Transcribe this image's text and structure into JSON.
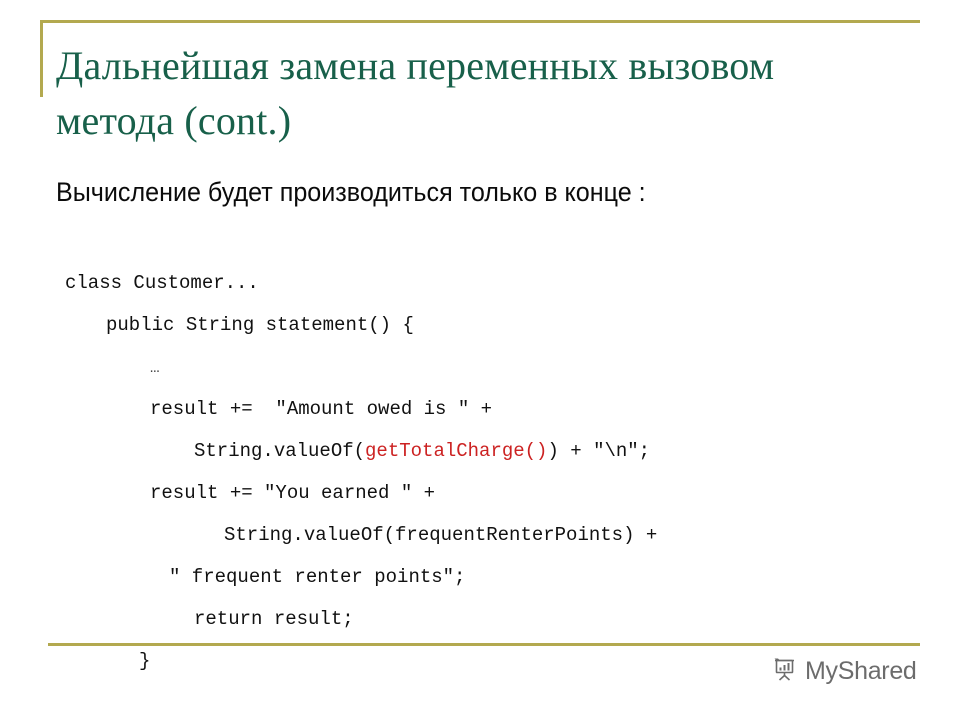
{
  "slide": {
    "title": "Дальнейшая замена переменных вызовом метода (cont.)",
    "subtitle": "Вычисление будет производиться только в конце :",
    "accent_gold": "#b3a94f",
    "title_green": "#18604a",
    "code_red": "#cc2222",
    "code_black": "#111111",
    "background": "#ffffff"
  },
  "code": {
    "lines": [
      {
        "indent": "i0",
        "segments": [
          {
            "text": "class Customer...",
            "style": "plain"
          }
        ]
      },
      {
        "indent": "i1",
        "segments": [
          {
            "text": "public String statement() {",
            "style": "plain"
          }
        ]
      },
      {
        "indent": "i2",
        "segments": [
          {
            "text": "…",
            "style": "plain"
          }
        ]
      },
      {
        "indent": "i2",
        "segments": [
          {
            "text": "result +=  \"Amount owed is \" +",
            "style": "plain"
          }
        ]
      },
      {
        "indent": "i3",
        "segments": [
          {
            "text": "String.valueOf(",
            "style": "plain"
          },
          {
            "text": "getTotalCharge()",
            "style": "red"
          },
          {
            "text": ") + \"\\n\";",
            "style": "plain"
          }
        ]
      },
      {
        "indent": "i2",
        "segments": [
          {
            "text": "result += \"You earned \" +",
            "style": "plain"
          }
        ]
      },
      {
        "indent": "i4",
        "segments": [
          {
            "text": "String.valueOf(frequentRenterPoints) +",
            "style": "plain"
          }
        ]
      },
      {
        "indent": "i5",
        "segments": [
          {
            "text": "\" frequent renter points\";",
            "style": "plain"
          }
        ]
      },
      {
        "indent": "i3",
        "segments": [
          {
            "text": "return result;",
            "style": "plain"
          }
        ]
      },
      {
        "indent": "i6",
        "segments": [
          {
            "text": "}",
            "style": "plain"
          }
        ]
      }
    ]
  },
  "watermark": {
    "text": "MyShared",
    "icon": "presentation-chart-icon",
    "color": "#4d4d4d"
  }
}
